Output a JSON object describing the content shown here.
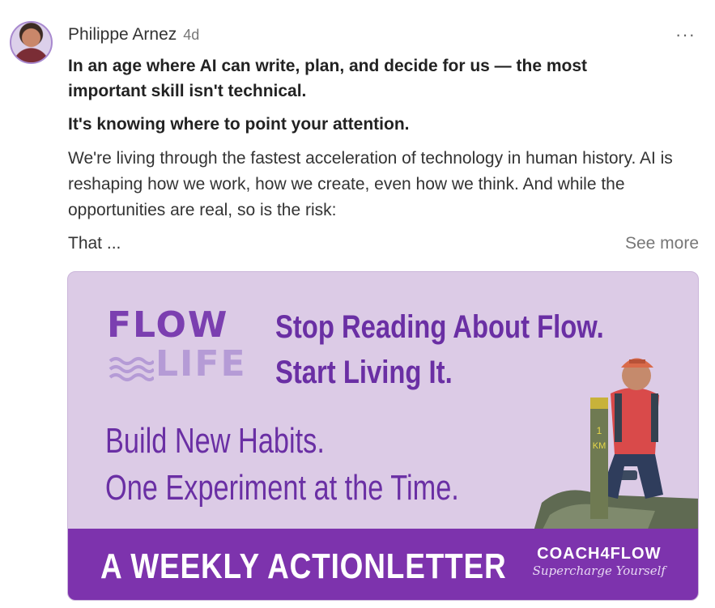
{
  "post": {
    "author": "Philippe Arnez",
    "time": "4d",
    "more_icon": "···",
    "headline": "In an age where AI can write, plan, and decide for us — the most important skill isn't technical.",
    "subhead": "It's knowing where to point your attention.",
    "body": "We're living through the fastest acceleration of technology in human history. AI is reshaping how we work, how we create, even how we think. And while the opportunities are real, so is the risk:",
    "teaser": "That ...",
    "see_more": "See more"
  },
  "banner": {
    "logo_line1": "FLOW",
    "logo_line2": "LIFE",
    "tagline1": "Stop Reading About Flow.",
    "tagline2": "Start Living It.",
    "habits1": "Build New Habits.",
    "habits2": "One Experiment at the Time.",
    "marker_number": "1",
    "marker_unit": "KM",
    "footer_title": "A WEEKLY ACTIONLETTER",
    "brand_name": "COACH4FLOW",
    "brand_slogan": "Supercharge Yourself",
    "colors": {
      "purple": "#7d33ad",
      "lavender": "#dccbe6",
      "text_purple": "#6a2fa4"
    }
  }
}
